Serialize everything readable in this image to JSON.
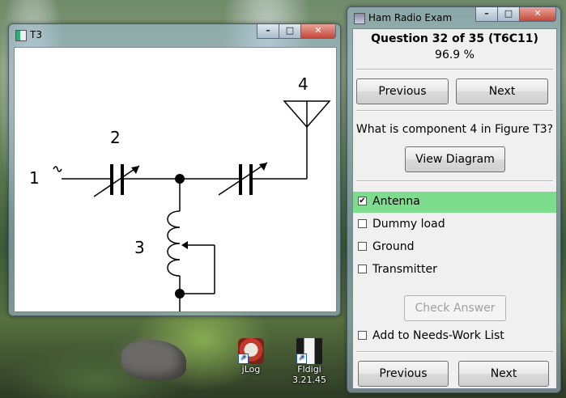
{
  "diagram_window": {
    "title": "T3",
    "controls": [
      "–",
      "□",
      "✕"
    ],
    "labels": [
      "1",
      "2",
      "3",
      "4"
    ]
  },
  "exam_window": {
    "title": "Ham Radio Exam",
    "controls": [
      "–",
      "□",
      "✕"
    ],
    "header": "Question 32 of 35 (T6C11)",
    "percent": "96.9 %",
    "previous_top": "Previous",
    "next_top": "Next",
    "question": "What is component 4 in Figure T3?",
    "view_diagram": "View Diagram",
    "options": [
      {
        "label": "Antenna",
        "checked": true
      },
      {
        "label": "Dummy load",
        "checked": false
      },
      {
        "label": "Ground",
        "checked": false
      },
      {
        "label": "Transmitter",
        "checked": false
      }
    ],
    "check_answer": "Check Answer",
    "needs_work": "Add to Needs-Work List",
    "previous_bottom": "Previous",
    "next_bottom": "Next",
    "selected_color": "#7ddc8e"
  },
  "desktop_icons": [
    {
      "label": "jLog",
      "icon": "jlog-icon"
    },
    {
      "label": "Fldigi 3.21.45",
      "icon": "fldigi-icon"
    }
  ]
}
